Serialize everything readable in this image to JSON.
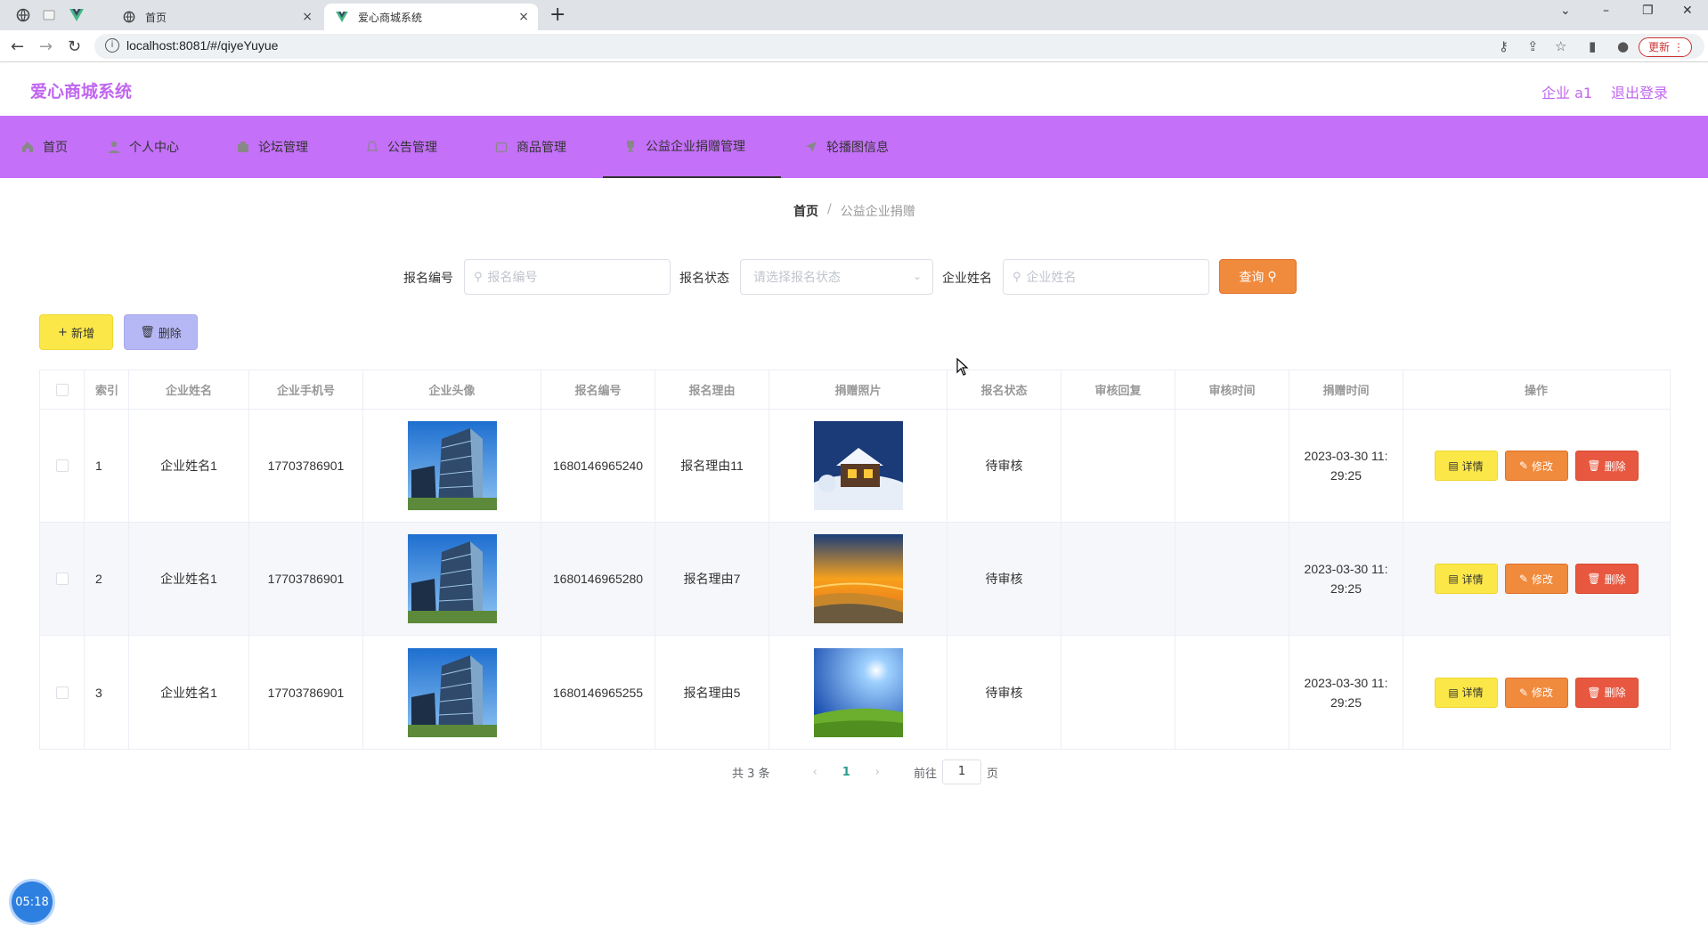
{
  "browser": {
    "tabs": [
      {
        "label": "首页",
        "close": "×"
      },
      {
        "label": "爱心商城系统",
        "close": "×"
      }
    ],
    "url": "localhost:8081/#/qiyeYuyue",
    "update_label": "更新"
  },
  "site": {
    "title": "爱心商城系统",
    "user": "企业 a1",
    "logout": "退出登录"
  },
  "nav": [
    {
      "label": "首页",
      "icon": "home-icon"
    },
    {
      "label": "个人中心",
      "icon": "user-icon"
    },
    {
      "label": "论坛管理",
      "icon": "forum-icon"
    },
    {
      "label": "公告管理",
      "icon": "notice-icon"
    },
    {
      "label": "商品管理",
      "icon": "goods-icon"
    },
    {
      "label": "公益企业捐赠管理",
      "icon": "donation-icon",
      "active": true
    },
    {
      "label": "轮播图信息",
      "icon": "carousel-icon"
    }
  ],
  "breadcrumb": {
    "home": "首页",
    "sep": "/",
    "current": "公益企业捐赠"
  },
  "search": {
    "field1_label": "报名编号",
    "field1_placeholder": "报名编号",
    "field2_label": "报名状态",
    "field2_placeholder": "请选择报名状态",
    "field3_label": "企业姓名",
    "field3_placeholder": "企业姓名",
    "query_label": "查询"
  },
  "actions": {
    "add_label": "新增",
    "delete_label": "删除"
  },
  "table": {
    "headers": [
      "索引",
      "企业姓名",
      "企业手机号",
      "企业头像",
      "报名编号",
      "报名理由",
      "捐赠照片",
      "报名状态",
      "审核回复",
      "审核时间",
      "捐赠时间",
      "操作"
    ],
    "rows": [
      {
        "index": "1",
        "name": "企业姓名1",
        "phone": "17703786901",
        "avatar": "building",
        "code": "1680146965240",
        "reason": "报名理由11",
        "photo": "snow-house",
        "status": "待审核",
        "reply": "",
        "review_time": "",
        "time1": "2023-03-30 11:",
        "time2": "29:25"
      },
      {
        "index": "2",
        "name": "企业姓名1",
        "phone": "17703786901",
        "avatar": "building",
        "code": "1680146965280",
        "reason": "报名理由7",
        "photo": "sunset-beach",
        "status": "待审核",
        "reply": "",
        "review_time": "",
        "time1": "2023-03-30 11:",
        "time2": "29:25"
      },
      {
        "index": "3",
        "name": "企业姓名1",
        "phone": "17703786901",
        "avatar": "building",
        "code": "1680146965255",
        "reason": "报名理由5",
        "photo": "sky-meadow",
        "status": "待审核",
        "reply": "",
        "review_time": "",
        "time1": "2023-03-30 11:",
        "time2": "29:25"
      }
    ],
    "op_detail": "详情",
    "op_edit": "修改",
    "op_delete": "删除"
  },
  "pager": {
    "total": "共 3 条",
    "prev": "‹",
    "current": "1",
    "next": "›",
    "goto_pre": "前往",
    "goto_value": "1",
    "goto_post": "页"
  },
  "clock": "05:18",
  "colors": {
    "accent": "#c470f8",
    "title": "#c166f0",
    "query": "#f08a3c",
    "add": "#fbe748",
    "remove": "#e8573f"
  }
}
